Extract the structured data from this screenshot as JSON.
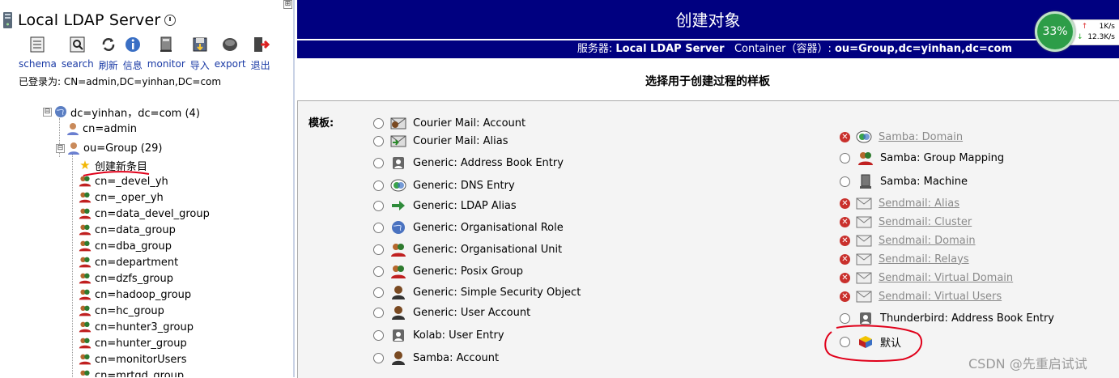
{
  "left": {
    "title": "Local LDAP Server",
    "collapse": "⊞",
    "toolbar": [
      {
        "label": "schema",
        "icon": "schema-icon"
      },
      {
        "label": "search",
        "icon": "search-icon"
      },
      {
        "label": "刷新",
        "icon": "refresh-icon"
      },
      {
        "label": "信息",
        "icon": "info-icon"
      },
      {
        "label": "monitor",
        "icon": "monitor-icon"
      },
      {
        "label": "导入",
        "icon": "import-icon"
      },
      {
        "label": "export",
        "icon": "export-icon"
      },
      {
        "label": "退出",
        "icon": "logout-icon"
      }
    ],
    "login": "已登录为: CN=admin,DC=yinhan,DC=com",
    "tree": {
      "root": {
        "label": "dc=yinhan，dc=com (4)",
        "toggle": "⊟"
      },
      "admin": "cn=admin",
      "group": {
        "label": "ou=Group (29)",
        "toggle": "⊟"
      },
      "create": "创建新条目",
      "groups": [
        "cn=_devel_yh",
        "cn=_oper_yh",
        "cn=data_devel_group",
        "cn=data_group",
        "cn=dba_group",
        "cn=department",
        "cn=dzfs_group",
        "cn=hadoop_group",
        "cn=hc_group",
        "cn=hunter3_group",
        "cn=hunter_group",
        "cn=monitorUsers",
        "cn=mrtqd_group"
      ]
    }
  },
  "right": {
    "header_title": "创建对象",
    "server_label": "服务器: ",
    "server_name": "Local LDAP Server",
    "container_label": "Container（容器）: ",
    "container_value": "ou=Group,dc=yinhan,dc=com",
    "subtitle": "选择用于创建过程的样板",
    "template_label": "模板:",
    "left_templates": [
      {
        "label": "Courier Mail: Account",
        "icon": "courier-account-icon"
      },
      {
        "label": "Courier Mail: Alias",
        "icon": "courier-alias-icon"
      },
      {
        "label": "Generic: Address Book Entry",
        "icon": "address-book-icon"
      },
      {
        "label": "Generic: DNS Entry",
        "icon": "dns-icon"
      },
      {
        "label": "Generic: LDAP Alias",
        "icon": "ldap-alias-icon"
      },
      {
        "label": "Generic: Organisational Role",
        "icon": "globe-icon"
      },
      {
        "label": "Generic: Organisational Unit",
        "icon": "ou-icon"
      },
      {
        "label": "Generic: Posix Group",
        "icon": "posix-group-icon"
      },
      {
        "label": "Generic: Simple Security Object",
        "icon": "user-icon"
      },
      {
        "label": "Generic: User Account",
        "icon": "user-icon"
      },
      {
        "label": "Kolab: User Entry",
        "icon": "address-book-icon"
      },
      {
        "label": "Samba: Account",
        "icon": "user-icon"
      }
    ],
    "right_templates": [
      {
        "label": "Samba: Domain",
        "icon": "dns-icon",
        "disabled": true
      },
      {
        "label": "Samba: Group Mapping",
        "icon": "posix-group-icon",
        "disabled": false
      },
      {
        "label": "Samba: Machine",
        "icon": "computer-icon",
        "disabled": false
      },
      {
        "label": "Sendmail: Alias",
        "icon": "mail-icon",
        "disabled": true
      },
      {
        "label": "Sendmail: Cluster",
        "icon": "mail-icon",
        "disabled": true
      },
      {
        "label": "Sendmail: Domain",
        "icon": "mail-icon",
        "disabled": true
      },
      {
        "label": "Sendmail: Relays",
        "icon": "mail-icon",
        "disabled": true
      },
      {
        "label": "Sendmail: Virtual Domain",
        "icon": "mail-icon",
        "disabled": true
      },
      {
        "label": "Sendmail: Virtual Users",
        "icon": "mail-icon",
        "disabled": true
      },
      {
        "label": "Thunderbird: Address Book Entry",
        "icon": "address-book-icon",
        "disabled": false
      },
      {
        "label": "默认",
        "icon": "default-object-icon",
        "disabled": false
      }
    ]
  },
  "widget": {
    "percent": "33%",
    "up": "1K/s",
    "down": "12.3K/s"
  },
  "watermark": "CSDN @先重启试试",
  "colors": {
    "header_bg": "#000080",
    "link": "#1a3aa5",
    "annotation": "#e0001a",
    "widget_green": "#2d9d48"
  }
}
